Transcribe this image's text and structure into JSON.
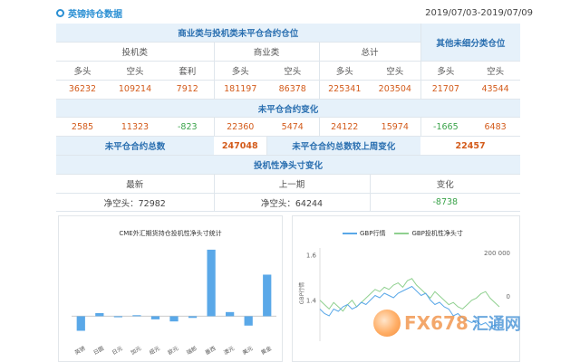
{
  "header": {
    "title": "英镑持仓数据",
    "date_range": "2019/07/03-2019/07/09"
  },
  "table": {
    "top_left": "商业类与投机类未平仓合约仓位",
    "top_right": "其他未细分类仓位",
    "groups": [
      "投机类",
      "商业类",
      "总计"
    ],
    "cols": [
      "多头",
      "空头",
      "套利",
      "多头",
      "空头",
      "多头",
      "空头",
      "多头",
      "空头"
    ],
    "oi_values": [
      "36232",
      "109214",
      "7912",
      "181197",
      "86378",
      "225341",
      "203504",
      "21707",
      "43544"
    ],
    "change_title": "未平仓合约变化",
    "change_values": [
      "2585",
      "11323",
      "-823",
      "22360",
      "5474",
      "24122",
      "15974",
      "-1665",
      "6483"
    ],
    "total_label": "未平仓合约总数",
    "total_value": "247048",
    "weekly_label": "未平仓合约总数较上周变化",
    "weekly_value": "22457",
    "spec_title": "投机性净头寸变化",
    "spec_cols": [
      "最新",
      "上一期",
      "变化"
    ],
    "spec_values": [
      "净空头：72982",
      "净空头：64244",
      "-8738"
    ]
  },
  "left_chart": {
    "title": "CME外汇期货持仓投机性净头寸统计"
  },
  "chart_data": [
    {
      "type": "bar",
      "title": "CME外汇期货持仓投机性净头寸统计",
      "categories": [
        "英镑",
        "日圆",
        "日元",
        "加元",
        "纽元",
        "欧元",
        "瑞郎",
        "墨西",
        "澳元",
        "美元",
        "黄金"
      ],
      "values": [
        -70000,
        15000,
        -5000,
        5000,
        -15000,
        -25000,
        -8000,
        320000,
        20000,
        -45000,
        200000
      ],
      "ylim": [
        -120000,
        350000
      ],
      "colors": [
        "#5aa8e8"
      ]
    },
    {
      "type": "line",
      "series": [
        {
          "name": "GBP行情",
          "color": "#5aa8e8",
          "axis": "left"
        },
        {
          "name": "GBP投机性净头寸",
          "color": "#8fd08f",
          "axis": "right"
        }
      ],
      "left_axis": {
        "label": "GBP行情",
        "ticks": [
          "1.6",
          "1.4"
        ]
      },
      "right_axis": {
        "ticks": [
          "200 000",
          "0"
        ]
      },
      "gbp_price": [
        1.36,
        1.34,
        1.33,
        1.36,
        1.35,
        1.37,
        1.38,
        1.36,
        1.37,
        1.39,
        1.38,
        1.4,
        1.42,
        1.41,
        1.43,
        1.42,
        1.41,
        1.43,
        1.44,
        1.45,
        1.46,
        1.44,
        1.42,
        1.43,
        1.4,
        1.38,
        1.39,
        1.37,
        1.36,
        1.33,
        1.34,
        1.32,
        1.31,
        1.3,
        1.31,
        1.29,
        1.3,
        1.28,
        1.29,
        1.27
      ],
      "gbp_net": [
        -20000,
        -40000,
        -60000,
        -30000,
        -50000,
        -70000,
        -40000,
        -20000,
        -50000,
        -30000,
        -10000,
        10000,
        30000,
        20000,
        40000,
        30000,
        50000,
        60000,
        40000,
        70000,
        80000,
        50000,
        30000,
        10000,
        -10000,
        20000,
        0,
        -20000,
        -40000,
        -30000,
        -50000,
        -60000,
        -40000,
        -20000,
        -10000,
        10000,
        20000,
        -10000,
        -30000,
        -50000
      ]
    }
  ],
  "watermark": {
    "latin": "FX678",
    "cn": "汇通网"
  }
}
